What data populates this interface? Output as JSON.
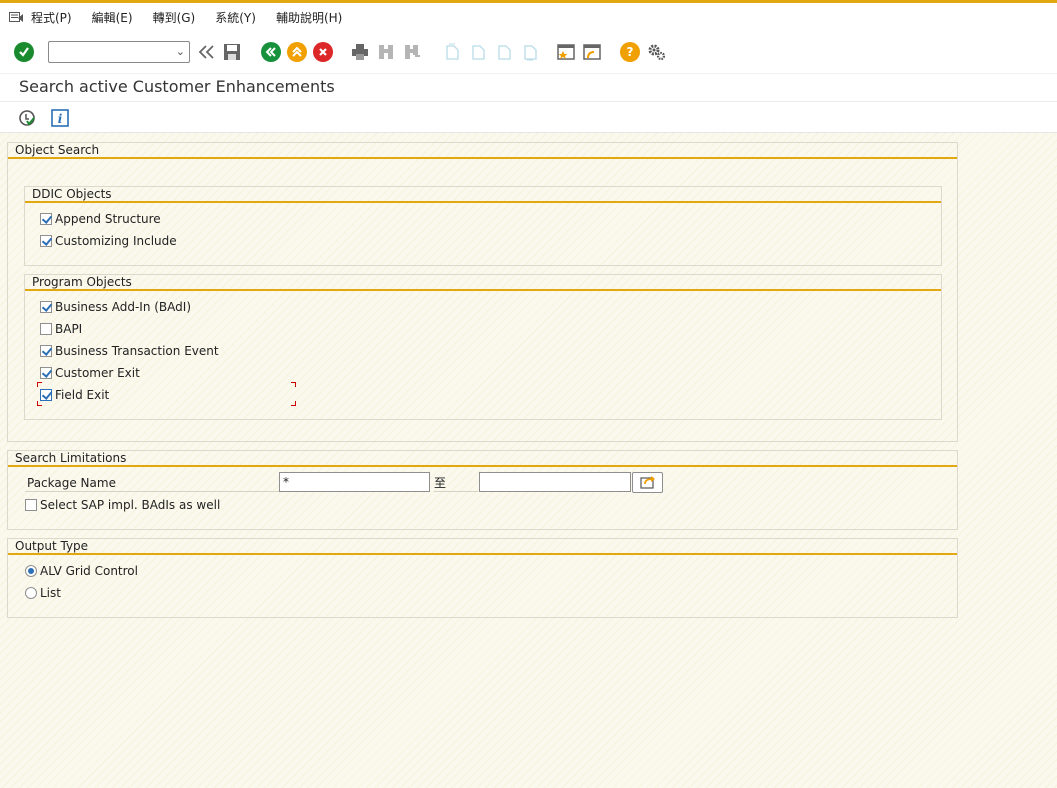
{
  "menu": {
    "items": [
      "程式(P)",
      "編輯(E)",
      "轉到(G)",
      "系統(Y)",
      "輔助說明(H)"
    ]
  },
  "toolbar": {
    "command_field_value": ""
  },
  "page": {
    "title": "Search active Customer Enhancements"
  },
  "object_search": {
    "title": "Object Search",
    "ddic": {
      "title": "DDIC Objects",
      "items": [
        {
          "label": "Append Structure",
          "checked": true
        },
        {
          "label": "Customizing Include",
          "checked": true
        }
      ]
    },
    "program": {
      "title": "Program Objects",
      "items": [
        {
          "label": "Business Add-In (BAdI)",
          "checked": true
        },
        {
          "label": "BAPI",
          "checked": false
        },
        {
          "label": "Business Transaction Event",
          "checked": true
        },
        {
          "label": "Customer Exit",
          "checked": true
        },
        {
          "label": "Field Exit",
          "checked": true
        }
      ]
    }
  },
  "search_limitations": {
    "title": "Search Limitations",
    "package_label": "Package Name",
    "package_from": "*",
    "to_label": "至",
    "package_to": "",
    "sap_badis_label": "Select SAP impl. BAdIs as well",
    "sap_badis_checked": false
  },
  "output_type": {
    "title": "Output Type",
    "options": [
      {
        "label": "ALV Grid Control",
        "selected": true
      },
      {
        "label": "List",
        "selected": false
      }
    ]
  },
  "colors": {
    "accent": "#e3a70f",
    "ok_green": "#1a8a2e",
    "back_green": "#17913c",
    "exit_orange": "#f0a000",
    "cancel_red": "#dc2828",
    "help_orange": "#f0a000",
    "check_blue": "#2b6fb6"
  }
}
